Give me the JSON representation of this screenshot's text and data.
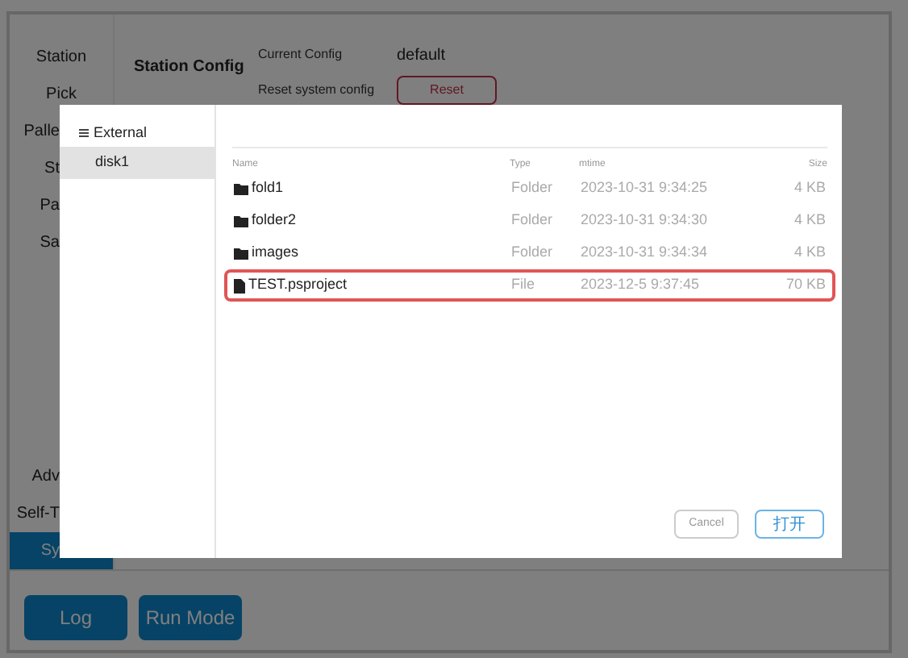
{
  "sidebar": {
    "items": [
      {
        "label": "Station",
        "selected": false
      },
      {
        "label": "Pick",
        "selected": false
      },
      {
        "label": "Palle",
        "selected": false
      },
      {
        "label": "St",
        "selected": false
      },
      {
        "label": "Pa",
        "selected": false
      },
      {
        "label": "Sa",
        "selected": false
      }
    ],
    "bottom_items": [
      {
        "label": "Adv",
        "selected": false
      },
      {
        "label": "Self-T",
        "selected": false
      },
      {
        "label": "Sy",
        "selected": true
      }
    ]
  },
  "section_title": "Station Config",
  "settings": [
    {
      "label": "Current Config",
      "value": "default",
      "kind": "text"
    },
    {
      "label": "Reset system config",
      "value": "Reset",
      "kind": "button"
    }
  ],
  "footer_buttons": [
    "Log",
    "Run Mode"
  ],
  "dialog": {
    "tree": {
      "root": "External",
      "children": [
        {
          "label": "disk1",
          "selected": true
        }
      ]
    },
    "columns": [
      "Name",
      "Type",
      "mtime",
      "Size"
    ],
    "rows": [
      {
        "kind": "folder",
        "name": "fold1",
        "type": "Folder",
        "mtime": "2023-10-31 9:34:25",
        "size": "4 KB",
        "selected": false
      },
      {
        "kind": "folder",
        "name": "folder2",
        "type": "Folder",
        "mtime": "2023-10-31 9:34:30",
        "size": "4 KB",
        "selected": false
      },
      {
        "kind": "folder",
        "name": "images",
        "type": "Folder",
        "mtime": "2023-10-31 9:34:34",
        "size": "4 KB",
        "selected": false
      },
      {
        "kind": "file",
        "name": "TEST.psproject",
        "type": "File",
        "mtime": "2023-12-5 9:37:45",
        "size": "70 KB",
        "selected": true
      }
    ],
    "buttons": {
      "cancel": "Cancel",
      "open": "打开"
    }
  }
}
